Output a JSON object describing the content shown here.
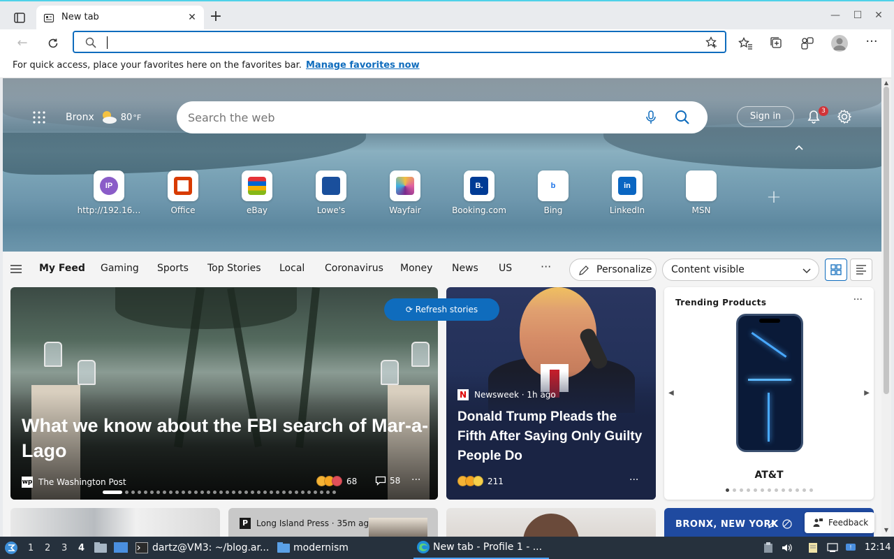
{
  "browser": {
    "tab_title": "New tab",
    "address_placeholder": "",
    "favorites_message": "For quick access, place your favorites here on the favorites bar.",
    "favorites_link": "Manage favorites now",
    "accent_color": "#0f6cbd"
  },
  "hero": {
    "location": "Bronx",
    "temperature": "80",
    "temp_unit": "°F",
    "search_placeholder": "Search the web",
    "sign_in": "Sign in",
    "notification_count": "3"
  },
  "quick_links": [
    {
      "label": "http://192.16…",
      "icon": "ip-icon",
      "glyph": "IP"
    },
    {
      "label": "Office",
      "icon": "office-icon",
      "glyph": ""
    },
    {
      "label": "eBay",
      "icon": "ebay-icon",
      "glyph": ""
    },
    {
      "label": "Lowe's",
      "icon": "lowes-icon",
      "glyph": ""
    },
    {
      "label": "Wayfair",
      "icon": "wayfair-icon",
      "glyph": ""
    },
    {
      "label": "Booking.com",
      "icon": "booking-icon",
      "glyph": "B."
    },
    {
      "label": "Bing",
      "icon": "bing-icon",
      "glyph": "b"
    },
    {
      "label": "LinkedIn",
      "icon": "linkedin-icon",
      "glyph": "in"
    },
    {
      "label": "MSN",
      "icon": "msn-icon",
      "glyph": ""
    }
  ],
  "feed": {
    "tabs": [
      "My Feed",
      "Gaming",
      "Sports",
      "Top Stories",
      "Local",
      "Coronavirus",
      "Money",
      "News",
      "US"
    ],
    "more": "···",
    "personalize": "Personalize",
    "content_visibility": "Content visible"
  },
  "cards": {
    "refresh_label": "Refresh stories",
    "main": {
      "title": "What we know about the FBI search of Mar-a-Lago",
      "source": "The Washington Post",
      "source_glyph": "wp",
      "reactions": "68",
      "comments": "58",
      "carousel_total": 35,
      "carousel_active": 1
    },
    "trump": {
      "source": "Newsweek · 1h ago",
      "source_glyph": "N",
      "title": "Donald Trump Pleads the Fifth After Saying Only Guilty People Do",
      "reactions": "211"
    },
    "trending": {
      "title": "Trending Products",
      "brand": "AT&T",
      "carousel_total": 13,
      "carousel_active": 1
    },
    "bottom_2_source": "Long Island Press · 35m ag",
    "bottom_2_glyph": "P",
    "bottom_4_title": "BRONX, NEW YORK",
    "feedback": "Feedback",
    "more": "···"
  },
  "taskbar": {
    "workspaces": [
      "1",
      "2",
      "3",
      "4"
    ],
    "current_workspace": "4",
    "terminal": "dartz@VM3: ~/blog.ar...",
    "folder": "modernism",
    "browser": "New tab - Profile 1 - ...",
    "clock": "12:14"
  }
}
